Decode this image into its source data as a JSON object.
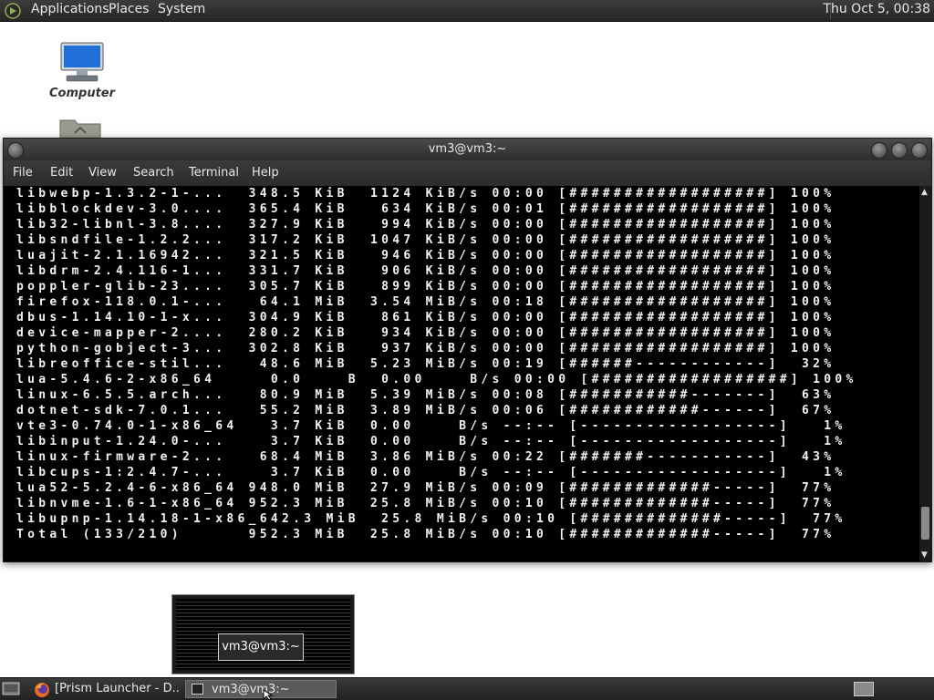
{
  "top_panel": {
    "menus": [
      "Applications",
      "Places",
      "System"
    ],
    "clock": "Thu Oct  5, 00:38"
  },
  "desktop": {
    "icons": [
      {
        "label": "Computer"
      }
    ]
  },
  "terminal": {
    "title": "vm3@vm3:~",
    "menu": [
      "File",
      "Edit",
      "View",
      "Search",
      "Terminal",
      "Help"
    ],
    "lines": [
      "libwebp-1.3.2-1-...  348.5 KiB  1124 KiB/s 00:00 [##################] 100%",
      "libblockdev-3.0....  365.4 KiB   634 KiB/s 00:01 [##################] 100%",
      "lib32-libnl-3.8....  327.9 KiB   994 KiB/s 00:00 [##################] 100%",
      "libsndfile-1.2.2...  317.2 KiB  1047 KiB/s 00:00 [##################] 100%",
      "luajit-2.1.16942...  321.5 KiB   946 KiB/s 00:00 [##################] 100%",
      "libdrm-2.4.116-1...  331.7 KiB   906 KiB/s 00:00 [##################] 100%",
      "poppler-glib-23....  305.7 KiB   899 KiB/s 00:00 [##################] 100%",
      "firefox-118.0.1-...   64.1 MiB  3.54 MiB/s 00:18 [##################] 100%",
      "dbus-1.14.10-1-x...  304.9 KiB   861 KiB/s 00:00 [##################] 100%",
      "device-mapper-2....  280.2 KiB   934 KiB/s 00:00 [##################] 100%",
      "python-gobject-3...  302.8 KiB   937 KiB/s 00:00 [##################] 100%",
      "libreoffice-stil...   48.6 MiB  5.23 MiB/s 00:19 [######------------]  32%",
      "lua-5.4.6-2-x86_64     0.0    B  0.00    B/s 00:00 [##################] 100%",
      "linux-6.5.5.arch...   80.9 MiB  5.39 MiB/s 00:08 [###########-------]  63%",
      "dotnet-sdk-7.0.1...   55.2 MiB  3.89 MiB/s 00:06 [############------]  67%",
      "vte3-0.74.0-1-x86_64   3.7 KiB  0.00    B/s --:-- [------------------]   1%",
      "libinput-1.24.0-...    3.7 KiB  0.00    B/s --:-- [------------------]   1%",
      "linux-firmware-2...   68.4 MiB  3.86 MiB/s 00:22 [#######-----------]  43%",
      "libcups-1:2.4.7-...    3.7 KiB  0.00    B/s --:-- [------------------]   1%",
      "lua52-5.2.4-6-x86_64 948.0 MiB  27.9 MiB/s 00:09 [#############-----]  77%",
      "libnvme-1.6-1-x86_64 952.3 MiB  25.8 MiB/s 00:10 [#############-----]  77%",
      "libupnp-1.14.18-1-x86_642.3 MiB  25.8 MiB/s 00:10 [#############-----]  77%",
      "Total (133/210)      952.3 MiB  25.8 MiB/s 00:10 [#############-----]  77%"
    ]
  },
  "preview": {
    "label": "vm3@vm3:~"
  },
  "taskbar": {
    "tasks": [
      {
        "label": "[Prism Launcher - D..."
      },
      {
        "label": "vm3@vm3:~"
      }
    ]
  }
}
